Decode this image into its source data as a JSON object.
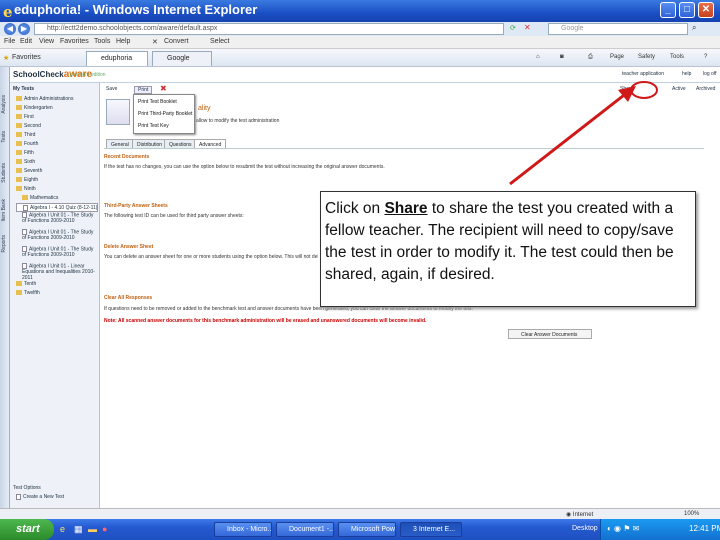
{
  "window": {
    "title": "eduphoria! - Windows Internet Explorer",
    "controls": [
      "_",
      "□",
      "✕"
    ]
  },
  "address": {
    "url": "http://ectt2demo.schoolobjects.com/aware/default.aspx",
    "search_placeholder": "Google"
  },
  "menu": [
    "File",
    "Edit",
    "View",
    "Favorites",
    "Tools",
    "Help"
  ],
  "menu_extras": {
    "convert": "Convert",
    "select": "Select"
  },
  "favbar": {
    "favorites": "Favorites",
    "tab_active": "eduphoria",
    "tab_other": "Google",
    "tools": [
      "Page",
      "Safety",
      "Tools"
    ]
  },
  "leftstrip_tabs": [
    "Analysis",
    "Tests",
    "Students",
    "Item Bank",
    "Reports"
  ],
  "app": {
    "logo_school": "School",
    "logo_check": "Check",
    "logo_aware": "aware",
    "edition": "premium edition",
    "top_links": {
      "teacher": "teacher application",
      "help": "help",
      "logoff": "log off"
    },
    "toolbar_right": {
      "share": "Share",
      "active": "Active",
      "archived": "Archived"
    }
  },
  "sidebar": {
    "header": "My Tests",
    "folders": [
      "Admin Administrations",
      "Kindergarten",
      "First",
      "Second",
      "Third",
      "Fourth",
      "Fifth",
      "Sixth",
      "Seventh",
      "Eighth",
      "Ninth"
    ],
    "subfolder": "Mathematics",
    "tests": [
      "Algebra I - 4.10 Quiz (8-12-11)",
      "Algebra I Unit 01 - The Study of Functions 2009-2010",
      "Algebra I Unit 01 - The Study of Functions 2009-2010",
      "Algebra I Unit 01 - The Study of Functions 2009-2010",
      "Algebra I Unit 01 - Linear Equations and Inequalities 2010-2011"
    ],
    "folders_after": [
      "Tenth",
      "Twelfth"
    ],
    "footer_header": "Test Options",
    "footer_item": "Create a New Test"
  },
  "main": {
    "toolbar": {
      "save": "Save",
      "print": "Print"
    },
    "dropdown": [
      "Print Test Booklet",
      "Print Third-Party Booklet",
      "Print Test Key"
    ],
    "header_fragment": "ality",
    "header_note": "allow to modify the test administration",
    "subtabs": [
      "General",
      "Distribution",
      "Questions",
      "Advanced"
    ],
    "sections": [
      {
        "title": "Recent Documents",
        "text": "If the test has no changes, you can use the option below to resubmit the test without increasing the original answer documents."
      },
      {
        "title": "Third-Party Answer Sheets",
        "text": "The following test ID can be used for third party answer sheets:"
      },
      {
        "title": "Delete Answer Sheet",
        "text": "You can delete an answer sheet for one or more students using the option below. This will not delete..."
      },
      {
        "title": "Clear All Responses",
        "text": "If questions need to be removed or added to the benchmark test and answer documents have been generated, you can clear the answer documents to modify the test."
      }
    ],
    "warning": "Note: All scanned answer documents for this benchmark administration will be erased and unanswered documents will become invalid.",
    "clear_button": "Clear Answer Documents"
  },
  "callout": {
    "before": "Click on ",
    "link": "Share",
    "after": " to share the test you created with a fellow teacher.  The recipient will need to copy/save the test in order to modify it.  The test could then be shared, again, if desired."
  },
  "status": {
    "zone": "Internet",
    "zoom": "100%"
  },
  "taskbar": {
    "start": "start",
    "tasks": [
      "Inbox - Micro...",
      "Document1 -...",
      "Microsoft Pow...",
      "3 Internet E..."
    ],
    "desktop": "Desktop",
    "clock": "12:41 PM"
  },
  "colors": {
    "titlebar": "#1a4fc4",
    "taskbar": "#2459d0",
    "start": "#2a8a2a",
    "aware": "#e07010",
    "arrow": "#d01818"
  }
}
